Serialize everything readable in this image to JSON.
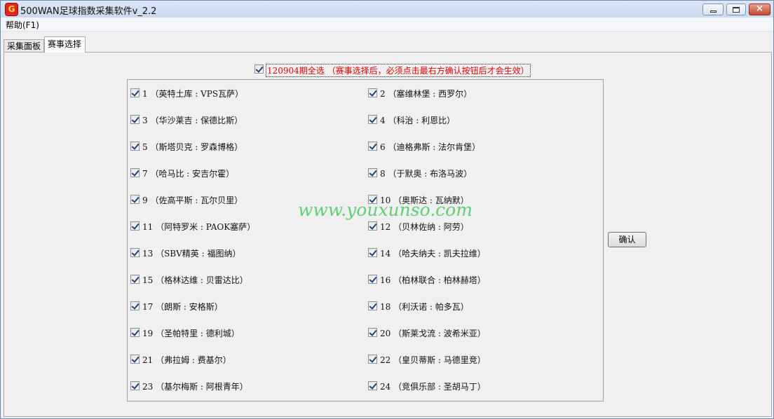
{
  "window": {
    "title": "500WAN足球指数采集软件v_2.2",
    "controls": {
      "close": "×"
    }
  },
  "menu": [
    {
      "label": "帮助(F1)"
    }
  ],
  "tabs": [
    {
      "label": "采集面板",
      "active": false
    },
    {
      "label": "赛事选择",
      "active": true
    }
  ],
  "select_all": {
    "checked": true,
    "label": "120904期全选  （赛事选择后，必须点击最右方确认按钮后才会生效）"
  },
  "matches": [
    {
      "label": "1 （英特土库 : VPS瓦萨）",
      "checked": true
    },
    {
      "label": "2 （塞维林堡 : 西罗尔）",
      "checked": true
    },
    {
      "label": "3 （华沙莱吉 : 保德比斯）",
      "checked": true
    },
    {
      "label": "4 （科治 : 利恩比）",
      "checked": true
    },
    {
      "label": "5 （斯塔贝克 : 罗森博格）",
      "checked": true
    },
    {
      "label": "6 （迪格弗斯 : 法尔肯堡）",
      "checked": true
    },
    {
      "label": "7 （哈马比 : 安吉尔霍）",
      "checked": true
    },
    {
      "label": "8 （于默奥 : 布洛马波）",
      "checked": true
    },
    {
      "label": "9 （佐高平斯 : 瓦尔贝里）",
      "checked": true
    },
    {
      "label": "10 （奥斯达 : 瓦纳默）",
      "checked": true
    },
    {
      "label": "11 （阿特罗米 : PAOK塞萨）",
      "checked": true
    },
    {
      "label": "12 （贝林佐纳 : 阿劳）",
      "checked": true
    },
    {
      "label": "13 （SBV精英 : 福图纳）",
      "checked": true
    },
    {
      "label": "14 （哈夫纳夫 : 凯夫拉维）",
      "checked": true
    },
    {
      "label": "15 （格林达维 : 贝雷达比）",
      "checked": true
    },
    {
      "label": "16 （柏林联合 : 柏林赫塔）",
      "checked": true
    },
    {
      "label": "17 （朗斯 : 安格斯）",
      "checked": true
    },
    {
      "label": "18 （利沃诺 : 帕多瓦）",
      "checked": true
    },
    {
      "label": "19 （圣帕特里 : 德利城）",
      "checked": true
    },
    {
      "label": "20 （斯莱戈流 : 波希米亚）",
      "checked": true
    },
    {
      "label": "21 （弗拉姆 : 费基尔）",
      "checked": true
    },
    {
      "label": "22 （皇贝蒂斯 : 马德里竞）",
      "checked": true
    },
    {
      "label": "23 （基尔梅斯 : 阿根青年）",
      "checked": true
    },
    {
      "label": "24 （竞俱乐部 : 圣胡马丁）",
      "checked": true
    }
  ],
  "confirm_button": {
    "label": "确认"
  },
  "watermark": "www.youxunso.com"
}
